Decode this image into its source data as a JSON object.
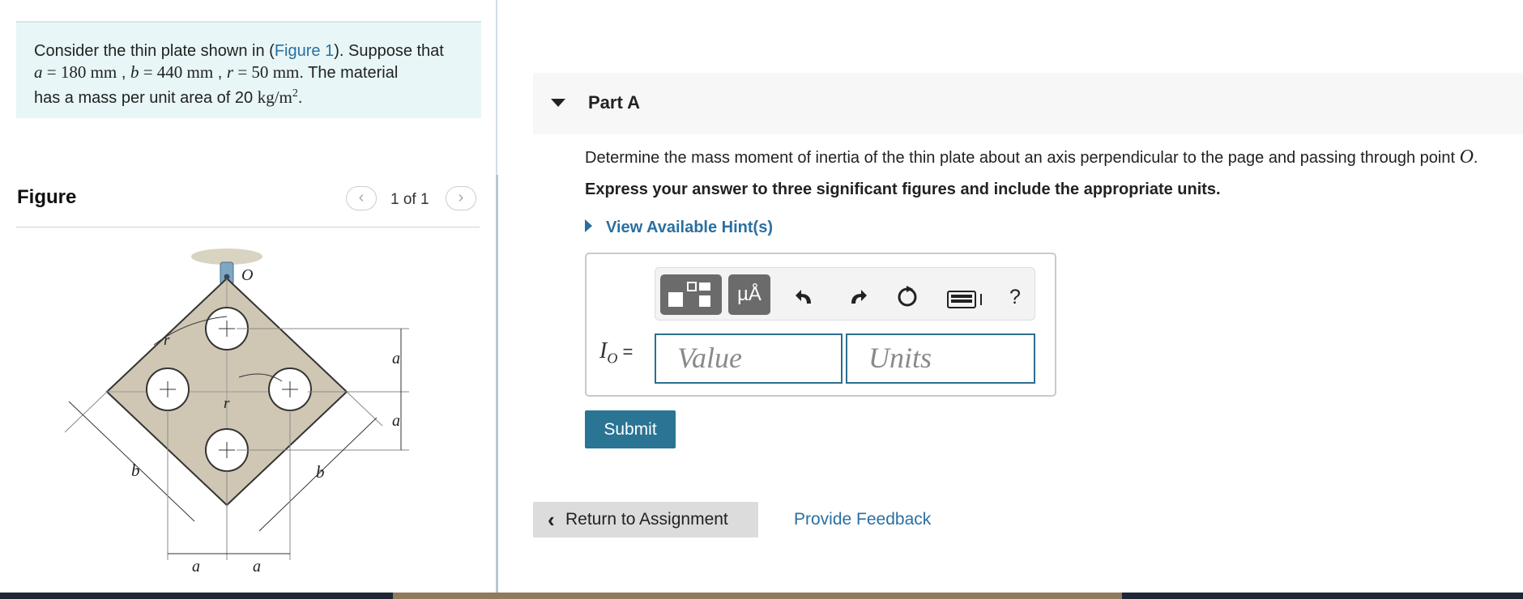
{
  "problem": {
    "intro": "Consider the thin plate shown in (",
    "figure_link": "Figure 1",
    "after_link": "). Suppose that",
    "a_var": "a",
    "a_eq": " = 180 ",
    "a_unit": "mm",
    "b_var": "b",
    "b_eq": " = 440 ",
    "b_unit": "mm",
    "r_var": "r",
    "r_eq": " = 50 ",
    "r_unit": "mm",
    "material_text": ". The material",
    "mass_text": "has a mass per unit area of 20 ",
    "mass_unit": "kg/m",
    "mass_exp": "2",
    "period": "."
  },
  "figure_panel": {
    "title": "Figure",
    "pager": "1 of 1",
    "prev_icon": "chevron-left-icon",
    "next_icon": "chevron-right-icon",
    "labels": {
      "o": "O",
      "a": "a",
      "b": "b",
      "r": "r"
    }
  },
  "part": {
    "title": "Part A",
    "question": "Determine the mass moment of inertia of the thin plate about an axis perpendicular to the page and passing through point ",
    "point": "O",
    "period": ".",
    "instruction": "Express your answer to three significant figures and include the appropriate units.",
    "hint_label": "View Available Hint(s)"
  },
  "answer": {
    "label_var": "I",
    "label_sub": "O",
    "label_eq": " =",
    "value_placeholder": "Value",
    "units_placeholder": "Units",
    "toolbar": {
      "units_button": "µÅ",
      "help": "?",
      "icons": [
        "templates-icon",
        "units-icon",
        "undo-icon",
        "redo-icon",
        "reset-icon",
        "keyboard-icon",
        "help-icon"
      ]
    }
  },
  "actions": {
    "submit": "Submit",
    "return": "Return to Assignment",
    "feedback": "Provide Feedback"
  },
  "colors": {
    "accent": "#2a7494",
    "link": "#2a6fa1",
    "problem_bg": "#e8f6f7"
  }
}
